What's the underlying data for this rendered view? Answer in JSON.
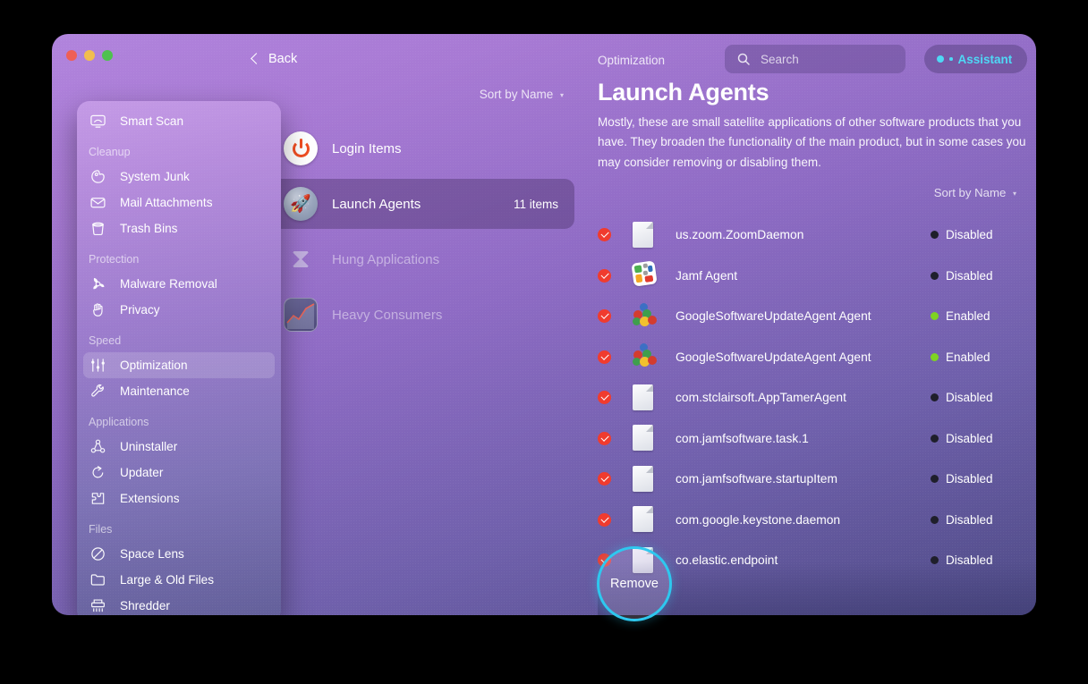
{
  "window": {
    "traffic_lights": [
      "close",
      "minimize",
      "zoom"
    ],
    "back_label": "Back"
  },
  "sidebar": {
    "groups": [
      {
        "header": "",
        "items": [
          {
            "label": "Smart Scan",
            "icon": "smart-scan-icon",
            "selected": false
          }
        ]
      },
      {
        "header": "Cleanup",
        "items": [
          {
            "label": "System Junk",
            "icon": "system-junk-icon",
            "selected": false
          },
          {
            "label": "Mail Attachments",
            "icon": "mail-attachments-icon",
            "selected": false
          },
          {
            "label": "Trash Bins",
            "icon": "trash-bins-icon",
            "selected": false
          }
        ]
      },
      {
        "header": "Protection",
        "items": [
          {
            "label": "Malware Removal",
            "icon": "malware-removal-icon",
            "selected": false
          },
          {
            "label": "Privacy",
            "icon": "privacy-icon",
            "selected": false
          }
        ]
      },
      {
        "header": "Speed",
        "items": [
          {
            "label": "Optimization",
            "icon": "optimization-icon",
            "selected": true
          },
          {
            "label": "Maintenance",
            "icon": "maintenance-icon",
            "selected": false
          }
        ]
      },
      {
        "header": "Applications",
        "items": [
          {
            "label": "Uninstaller",
            "icon": "uninstaller-icon",
            "selected": false
          },
          {
            "label": "Updater",
            "icon": "updater-icon",
            "selected": false
          },
          {
            "label": "Extensions",
            "icon": "extensions-icon",
            "selected": false
          }
        ]
      },
      {
        "header": "Files",
        "items": [
          {
            "label": "Space Lens",
            "icon": "space-lens-icon",
            "selected": false
          },
          {
            "label": "Large & Old Files",
            "icon": "large-old-files-icon",
            "selected": false
          },
          {
            "label": "Shredder",
            "icon": "shredder-icon",
            "selected": false
          }
        ]
      }
    ]
  },
  "middle": {
    "sort_label": "Sort by Name",
    "categories": [
      {
        "name": "Login Items",
        "icon": "power-icon",
        "check": "empty",
        "count": "",
        "dim": false
      },
      {
        "name": "Launch Agents",
        "icon": "rocket-icon",
        "check": "on",
        "count": "11 items",
        "dim": false,
        "selected": true
      },
      {
        "name": "Hung Applications",
        "icon": "hourglass-icon",
        "check": "none",
        "count": "",
        "dim": true
      },
      {
        "name": "Heavy Consumers",
        "icon": "chart-icon",
        "check": "none",
        "count": "",
        "dim": true
      }
    ]
  },
  "right": {
    "breadcrumb": "Optimization",
    "search_placeholder": "Search",
    "search_value": "",
    "assistant_label": "Assistant",
    "title": "Launch Agents",
    "description": "Mostly, these are small satellite applications of other software products that you have. They broaden the functionality of the main product, but in some cases you may consider removing or disabling them.",
    "sort_label": "Sort by Name",
    "item_count": "11 items",
    "agents": [
      {
        "name": "us.zoom.ZoomDaemon",
        "icon": "document-icon",
        "status": "Disabled",
        "checked": true
      },
      {
        "name": "Jamf Agent",
        "icon": "jamf-icon",
        "status": "Disabled",
        "checked": true
      },
      {
        "name": "GoogleSoftwareUpdateAgent Agent",
        "icon": "balloons-icon",
        "status": "Enabled",
        "checked": true
      },
      {
        "name": "GoogleSoftwareUpdateAgent Agent",
        "icon": "balloons-icon",
        "status": "Enabled",
        "checked": true
      },
      {
        "name": "com.stclairsoft.AppTamerAgent",
        "icon": "document-icon",
        "status": "Disabled",
        "checked": true
      },
      {
        "name": "com.jamfsoftware.task.1",
        "icon": "document-icon",
        "status": "Disabled",
        "checked": true
      },
      {
        "name": "com.jamfsoftware.startupItem",
        "icon": "document-icon",
        "status": "Disabled",
        "checked": true
      },
      {
        "name": "com.google.keystone.daemon",
        "icon": "document-icon",
        "status": "Disabled",
        "checked": true
      },
      {
        "name": "co.elastic.endpoint",
        "icon": "document-icon",
        "status": "Disabled",
        "checked": true
      }
    ]
  },
  "cursor_highlight": {
    "label": "Remove"
  },
  "colors": {
    "checkbox_red": "#f03b2e",
    "status_enabled": "#7ed321",
    "status_disabled": "#1f1f2b",
    "assistant_cyan": "#4fd8f5",
    "highlight_ring": "#2ec8ef"
  }
}
